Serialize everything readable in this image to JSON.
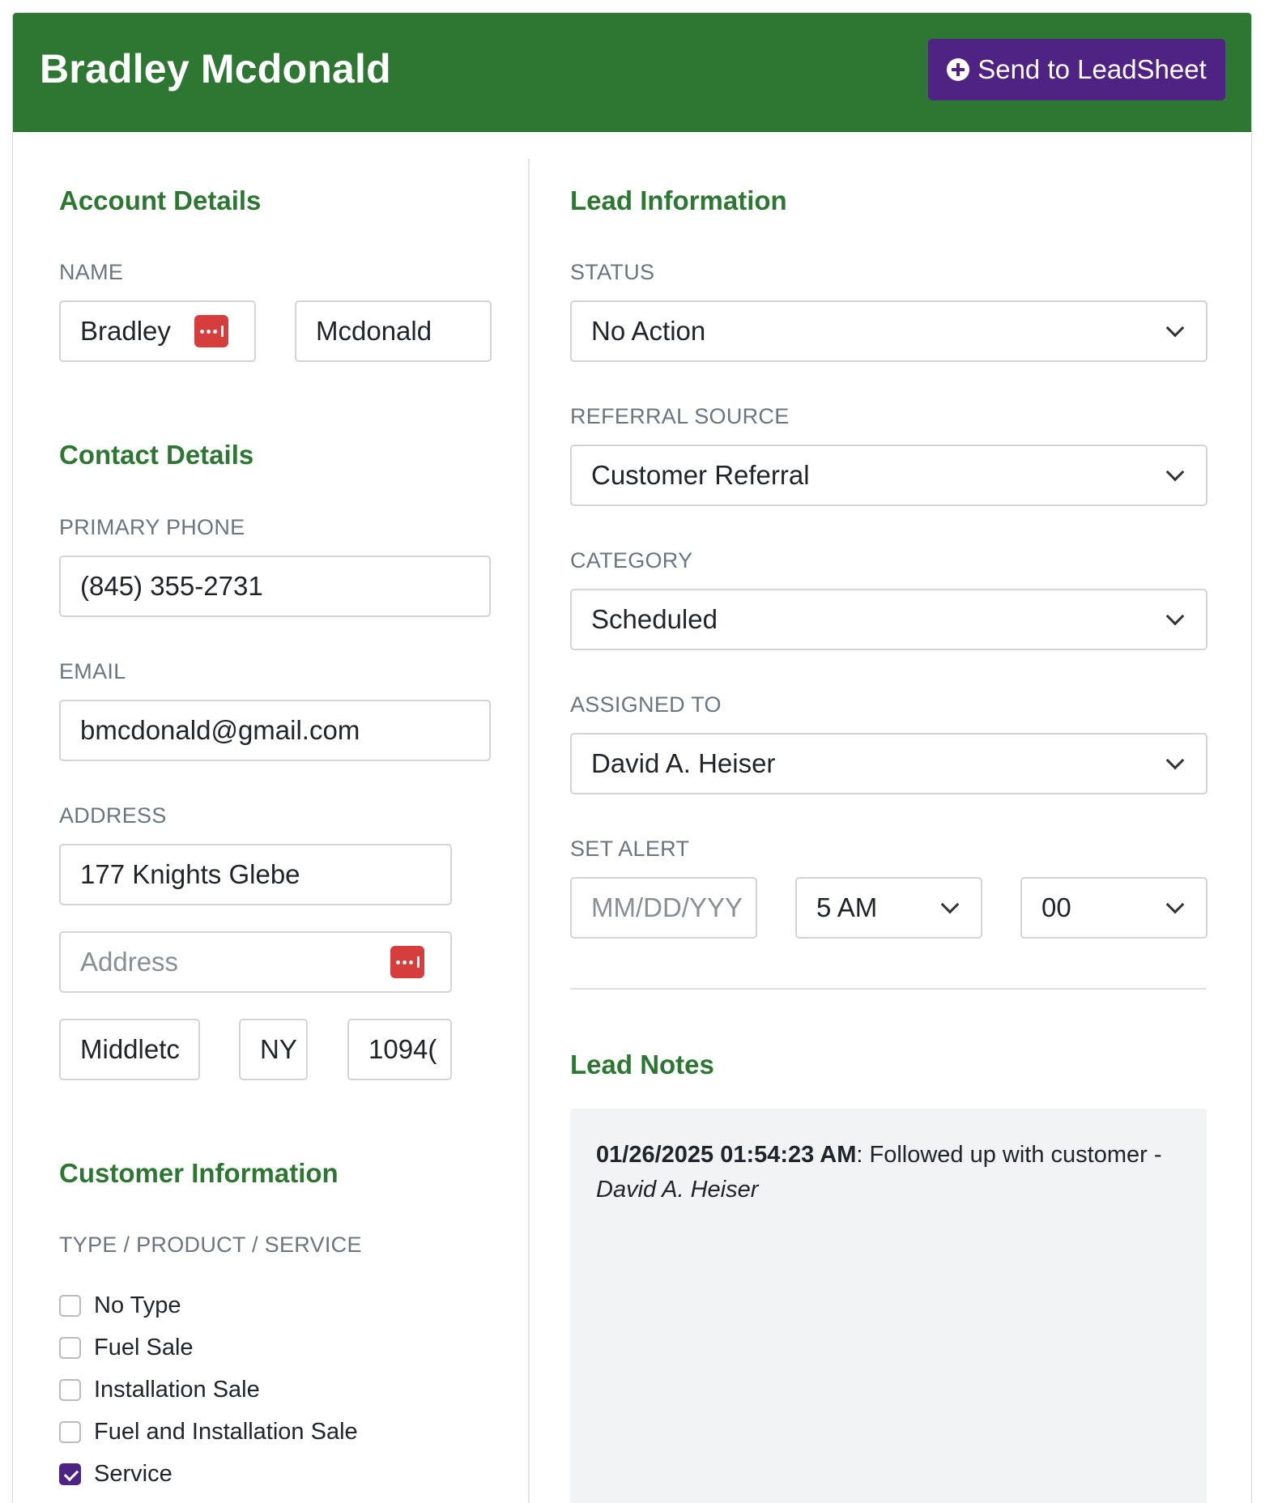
{
  "header": {
    "title": "Bradley Mcdonald",
    "send_button_label": "Send to LeadSheet"
  },
  "account": {
    "section_title": "Account Details",
    "name_label": "NAME",
    "first_name": "Bradley",
    "last_name": "Mcdonald"
  },
  "contact": {
    "section_title": "Contact Details",
    "phone_label": "PRIMARY PHONE",
    "phone": "(845) 355-2731",
    "email_label": "EMAIL",
    "email": "bmcdonald@gmail.com",
    "address_label": "ADDRESS",
    "address_line1": "177 Knights Glebe",
    "address_line2_placeholder": "Address",
    "city": "Middletc",
    "state": "NY",
    "zip": "1094("
  },
  "customer": {
    "section_title": "Customer Information",
    "type_label": "TYPE / PRODUCT / SERVICE",
    "types": [
      {
        "label": "No Type",
        "checked": false
      },
      {
        "label": "Fuel Sale",
        "checked": false
      },
      {
        "label": "Installation Sale",
        "checked": false
      },
      {
        "label": "Fuel and Installation Sale",
        "checked": false
      },
      {
        "label": "Service",
        "checked": true
      }
    ]
  },
  "lead": {
    "section_title": "Lead Information",
    "status_label": "STATUS",
    "status": "No Action",
    "referral_label": "REFERRAL SOURCE",
    "referral": "Customer Referral",
    "category_label": "CATEGORY",
    "category": "Scheduled",
    "assigned_label": "ASSIGNED TO",
    "assigned": "David A. Heiser",
    "alert_label": "SET ALERT",
    "alert_date_placeholder": "MM/DD/YYY",
    "alert_hour": "5 AM",
    "alert_minute": "00"
  },
  "notes": {
    "section_title": "Lead Notes",
    "items": [
      {
        "timestamp": "01/26/2025 01:54:23 AM",
        "text": ": Followed up with customer - ",
        "author": "David A. Heiser"
      }
    ]
  },
  "colors": {
    "header_green": "#2e7733",
    "accent_purple": "#4f2383",
    "password_badge_red": "#d63d3d"
  }
}
